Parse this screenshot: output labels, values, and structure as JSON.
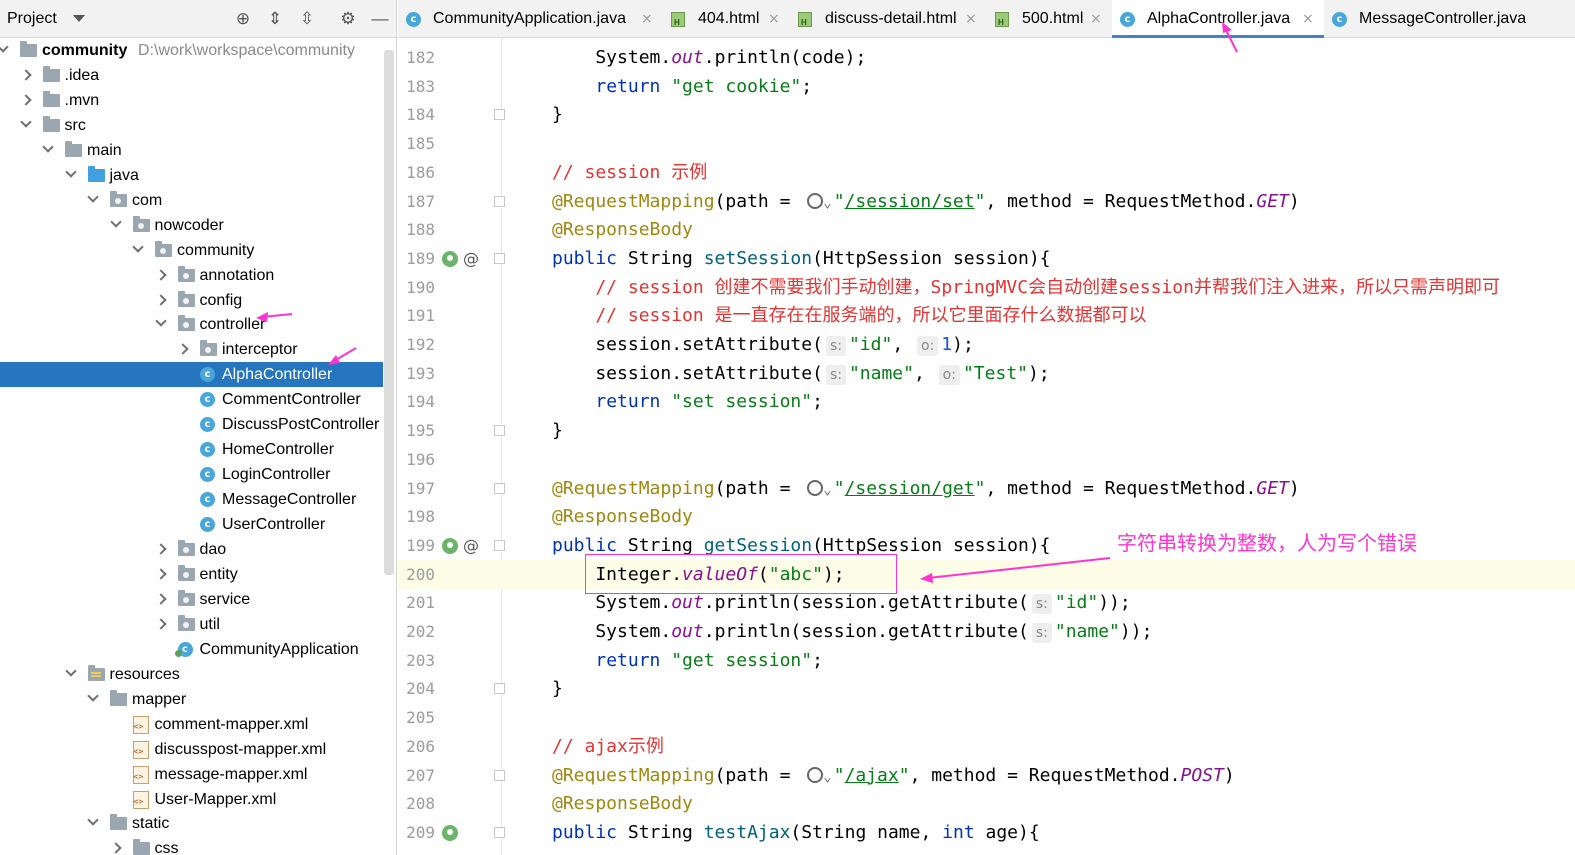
{
  "project_panel": {
    "title": "Project",
    "toolbar_icons": [
      "locate-icon",
      "expand-all-icon",
      "collapse-all-icon",
      "gear-icon",
      "minimize-icon"
    ],
    "tree": [
      {
        "label": "community",
        "path": "D:\\work\\workspace\\community",
        "icon": "folder",
        "state": "expanded",
        "bold": true
      },
      {
        "label": ".idea",
        "icon": "folder",
        "state": "collapsed"
      },
      {
        "label": ".mvn",
        "icon": "folder",
        "state": "collapsed"
      },
      {
        "label": "src",
        "icon": "folder",
        "state": "expanded"
      },
      {
        "label": "main",
        "icon": "folder",
        "state": "expanded"
      },
      {
        "label": "java",
        "icon": "folder-blue",
        "state": "expanded"
      },
      {
        "label": "com",
        "icon": "package",
        "state": "expanded"
      },
      {
        "label": "nowcoder",
        "icon": "package",
        "state": "expanded"
      },
      {
        "label": "community",
        "icon": "package",
        "state": "expanded"
      },
      {
        "label": "annotation",
        "icon": "package",
        "state": "collapsed"
      },
      {
        "label": "config",
        "icon": "package",
        "state": "collapsed"
      },
      {
        "label": "controller",
        "icon": "package",
        "state": "expanded"
      },
      {
        "label": "interceptor",
        "icon": "package",
        "state": "collapsed"
      },
      {
        "label": "AlphaController",
        "icon": "class",
        "state": "leaf",
        "selected": true
      },
      {
        "label": "CommentController",
        "icon": "class",
        "state": "leaf"
      },
      {
        "label": "DiscussPostController",
        "icon": "class",
        "state": "leaf"
      },
      {
        "label": "HomeController",
        "icon": "class",
        "state": "leaf"
      },
      {
        "label": "LoginController",
        "icon": "class",
        "state": "leaf"
      },
      {
        "label": "MessageController",
        "icon": "class",
        "state": "leaf"
      },
      {
        "label": "UserController",
        "icon": "class",
        "state": "leaf"
      },
      {
        "label": "dao",
        "icon": "package",
        "state": "collapsed"
      },
      {
        "label": "entity",
        "icon": "package",
        "state": "collapsed"
      },
      {
        "label": "service",
        "icon": "package",
        "state": "collapsed"
      },
      {
        "label": "util",
        "icon": "package",
        "state": "collapsed"
      },
      {
        "label": "CommunityApplication",
        "icon": "app-class",
        "state": "leaf"
      },
      {
        "label": "resources",
        "icon": "folder-res",
        "state": "expanded"
      },
      {
        "label": "mapper",
        "icon": "folder",
        "state": "expanded"
      },
      {
        "label": "comment-mapper.xml",
        "icon": "xml",
        "state": "leaf"
      },
      {
        "label": "discusspost-mapper.xml",
        "icon": "xml",
        "state": "leaf"
      },
      {
        "label": "message-mapper.xml",
        "icon": "xml",
        "state": "leaf"
      },
      {
        "label": "User-Mapper.xml",
        "icon": "xml",
        "state": "leaf"
      },
      {
        "label": "static",
        "icon": "folder",
        "state": "expanded"
      },
      {
        "label": "css",
        "icon": "folder",
        "state": "collapsed"
      }
    ]
  },
  "tabs": [
    {
      "label": "CommunityApplication.java",
      "icon": "class",
      "active": false
    },
    {
      "label": "404.html",
      "icon": "html",
      "active": false
    },
    {
      "label": "discuss-detail.html",
      "icon": "html",
      "active": false
    },
    {
      "label": "500.html",
      "icon": "html",
      "active": false
    },
    {
      "label": "AlphaController.java",
      "icon": "class",
      "active": true
    },
    {
      "label": "MessageController.java",
      "icon": "class",
      "active": false
    }
  ],
  "editor": {
    "current_line": 200,
    "lines": [
      {
        "n": 182,
        "t": [
          [
            "    System.",
            ""
          ],
          [
            "out",
            "fld"
          ],
          [
            ".println(code);",
            ""
          ]
        ]
      },
      {
        "n": 183,
        "t": [
          [
            "    ",
            ""
          ],
          [
            "return ",
            "kw"
          ],
          [
            "\"get cookie\"",
            "str"
          ],
          [
            ";",
            ""
          ]
        ]
      },
      {
        "n": 184,
        "t": [
          [
            "}",
            ""
          ]
        ],
        "fold": true
      },
      {
        "n": 185,
        "t": []
      },
      {
        "n": 186,
        "t": [
          [
            "// session 示例",
            "cmt"
          ]
        ]
      },
      {
        "n": 187,
        "t": [
          [
            "@RequestMapping",
            "ann"
          ],
          [
            "(path = ",
            ""
          ],
          [
            "",
            "globe"
          ],
          [
            "\"",
            "str"
          ],
          [
            "/session/set",
            "link"
          ],
          [
            "\"",
            "str"
          ],
          [
            ", method = RequestMethod.",
            ""
          ],
          [
            "GET",
            "fld"
          ],
          [
            ")",
            ""
          ]
        ],
        "fold": true
      },
      {
        "n": 188,
        "t": [
          [
            "@ResponseBody",
            "ann"
          ]
        ]
      },
      {
        "n": 189,
        "t": [
          [
            "public ",
            "kw"
          ],
          [
            "String ",
            ""
          ],
          [
            "setSession",
            "fn"
          ],
          [
            "(HttpSession session){",
            ""
          ]
        ],
        "marks": true,
        "fold": true
      },
      {
        "n": 190,
        "t": [
          [
            "    // session 创建不需要我们手动创建，SpringMVC会自动创建session并帮我们注入进来，所以只需声明即可",
            "cmt"
          ]
        ]
      },
      {
        "n": 191,
        "t": [
          [
            "    // session 是一直存在在服务端的，所以它里面存什么数据都可以",
            "cmt"
          ]
        ]
      },
      {
        "n": 192,
        "t": [
          [
            "    session.setAttribute(",
            ""
          ],
          [
            "s:",
            "hint"
          ],
          [
            "\"id\"",
            "str"
          ],
          [
            ", ",
            ""
          ],
          [
            "o:",
            "hint"
          ],
          [
            "1",
            "num"
          ],
          [
            ");",
            ""
          ]
        ]
      },
      {
        "n": 193,
        "t": [
          [
            "    session.setAttribute(",
            ""
          ],
          [
            "s:",
            "hint"
          ],
          [
            "\"name\"",
            "str"
          ],
          [
            ", ",
            ""
          ],
          [
            "o:",
            "hint"
          ],
          [
            "\"Test\"",
            "str"
          ],
          [
            ");",
            ""
          ]
        ]
      },
      {
        "n": 194,
        "t": [
          [
            "    ",
            ""
          ],
          [
            "return ",
            "kw"
          ],
          [
            "\"set session\"",
            "str"
          ],
          [
            ";",
            ""
          ]
        ]
      },
      {
        "n": 195,
        "t": [
          [
            "}",
            ""
          ]
        ],
        "fold": true
      },
      {
        "n": 196,
        "t": []
      },
      {
        "n": 197,
        "t": [
          [
            "@RequestMapping",
            "ann"
          ],
          [
            "(path = ",
            ""
          ],
          [
            "",
            "globe"
          ],
          [
            "\"",
            "str"
          ],
          [
            "/session/get",
            "link"
          ],
          [
            "\"",
            "str"
          ],
          [
            ", method = RequestMethod.",
            ""
          ],
          [
            "GET",
            "fld"
          ],
          [
            ")",
            ""
          ]
        ],
        "fold": true
      },
      {
        "n": 198,
        "t": [
          [
            "@ResponseBody",
            "ann"
          ]
        ]
      },
      {
        "n": 199,
        "t": [
          [
            "public ",
            "kw"
          ],
          [
            "String ",
            ""
          ],
          [
            "getSession",
            "fn"
          ],
          [
            "(HttpSession session){",
            ""
          ]
        ],
        "marks": true,
        "fold": true
      },
      {
        "n": 200,
        "t": [
          [
            "    Integer.",
            ""
          ],
          [
            "valueOf",
            "fld"
          ],
          [
            "(",
            ""
          ],
          [
            "\"abc\"",
            "str"
          ],
          [
            ");",
            ""
          ]
        ]
      },
      {
        "n": 201,
        "t": [
          [
            "    System.",
            ""
          ],
          [
            "out",
            "fld"
          ],
          [
            ".println(session.getAttribute(",
            ""
          ],
          [
            "s:",
            "hint"
          ],
          [
            "\"id\"",
            "str"
          ],
          [
            "));",
            ""
          ]
        ]
      },
      {
        "n": 202,
        "t": [
          [
            "    System.",
            ""
          ],
          [
            "out",
            "fld"
          ],
          [
            ".println(session.getAttribute(",
            ""
          ],
          [
            "s:",
            "hint"
          ],
          [
            "\"name\"",
            "str"
          ],
          [
            "));",
            ""
          ]
        ]
      },
      {
        "n": 203,
        "t": [
          [
            "    ",
            ""
          ],
          [
            "return ",
            "kw"
          ],
          [
            "\"get session\"",
            "str"
          ],
          [
            ";",
            ""
          ]
        ]
      },
      {
        "n": 204,
        "t": [
          [
            "}",
            ""
          ]
        ],
        "fold": true
      },
      {
        "n": 205,
        "t": []
      },
      {
        "n": 206,
        "t": [
          [
            "// ajax示例",
            "cmt"
          ]
        ]
      },
      {
        "n": 207,
        "t": [
          [
            "@RequestMapping",
            "ann"
          ],
          [
            "(path = ",
            ""
          ],
          [
            "",
            "globe"
          ],
          [
            "\"",
            "str"
          ],
          [
            "/ajax",
            "link"
          ],
          [
            "\"",
            "str"
          ],
          [
            ", method = RequestMethod.",
            ""
          ],
          [
            "POST",
            "fld"
          ],
          [
            ")",
            ""
          ]
        ],
        "fold": true
      },
      {
        "n": 208,
        "t": [
          [
            "@ResponseBody",
            "ann"
          ]
        ]
      },
      {
        "n": 209,
        "t": [
          [
            "public ",
            "kw"
          ],
          [
            "String ",
            ""
          ],
          [
            "testAjax",
            "fn"
          ],
          [
            "(String name, ",
            ""
          ],
          [
            "int ",
            "kw"
          ],
          [
            "age){",
            ""
          ]
        ],
        "marks_no_at": true,
        "fold": true
      }
    ]
  },
  "annotation": {
    "note": "字符串转换为整数，人为写个错误",
    "color": "#ff33d1"
  }
}
